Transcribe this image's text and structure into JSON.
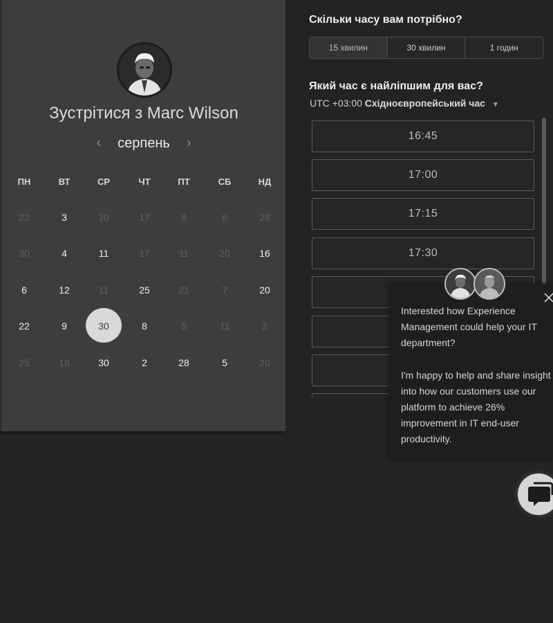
{
  "scheduler": {
    "title": "Зустрітися з Marc Wilson",
    "month": "серпень",
    "prev_icon": "chevron-left-icon",
    "next_icon": "chevron-right-icon",
    "weekdays": [
      "ПН",
      "ВТ",
      "СР",
      "ЧТ",
      "ПТ",
      "СБ",
      "НД"
    ],
    "weeks": [
      [
        {
          "d": "22",
          "muted": true
        },
        {
          "d": "3",
          "muted": false
        },
        {
          "d": "30",
          "muted": true
        },
        {
          "d": "17",
          "muted": true
        },
        {
          "d": "8",
          "muted": true
        },
        {
          "d": "6",
          "muted": true
        },
        {
          "d": "28",
          "muted": true
        }
      ],
      [
        {
          "d": "30",
          "muted": true
        },
        {
          "d": "4",
          "muted": false
        },
        {
          "d": "11",
          "muted": false
        },
        {
          "d": "17",
          "muted": true
        },
        {
          "d": "11",
          "muted": true
        },
        {
          "d": "20",
          "muted": true
        },
        {
          "d": "16",
          "muted": false
        }
      ],
      [
        {
          "d": "6",
          "muted": false
        },
        {
          "d": "12",
          "muted": false
        },
        {
          "d": "11",
          "muted": true
        },
        {
          "d": "25",
          "muted": false
        },
        {
          "d": "21",
          "muted": true
        },
        {
          "d": "7",
          "muted": true
        },
        {
          "d": "20",
          "muted": false
        }
      ],
      [
        {
          "d": "22",
          "muted": false
        },
        {
          "d": "9",
          "muted": false
        },
        {
          "d": "30",
          "muted": false,
          "selected": true
        },
        {
          "d": "8",
          "muted": false
        },
        {
          "d": "5",
          "muted": true
        },
        {
          "d": "11",
          "muted": true
        },
        {
          "d": "2",
          "muted": true
        }
      ],
      [
        {
          "d": "25",
          "muted": true
        },
        {
          "d": "18",
          "muted": true
        },
        {
          "d": "30",
          "muted": false
        },
        {
          "d": "2",
          "muted": false
        },
        {
          "d": "28",
          "muted": false
        },
        {
          "d": "5",
          "muted": false
        },
        {
          "d": "20",
          "muted": true
        }
      ]
    ]
  },
  "booking": {
    "duration_heading": "Скільки часу вам потрібно?",
    "durations": [
      "15 хвилин",
      "30 хвилин",
      "1 годин"
    ],
    "active_duration": 0,
    "time_heading": "Який час є найліпшим для вас?",
    "tz_offset": "UTC +03:00",
    "tz_name": "Східноєвропейський час",
    "slots": [
      "16:45",
      "17:00",
      "17:15",
      "17:30",
      "",
      "",
      "",
      ""
    ]
  },
  "chat": {
    "message_1": "Interested how Experience Management could help your IT department?",
    "message_2": "I'm happy to help and share insight into how our customers use our platform to achieve 26% improvement in IT end-user productivity.",
    "close_icon": "close-icon",
    "launcher_icon": "chat-bubble-icon"
  },
  "colors": {
    "page_bg": "#242424",
    "left_panel_bg": "#3d3d3d",
    "right_panel_bg": "#232323",
    "selected_day": "#d9d9d9",
    "popup_bg": "#1e1e1e"
  }
}
